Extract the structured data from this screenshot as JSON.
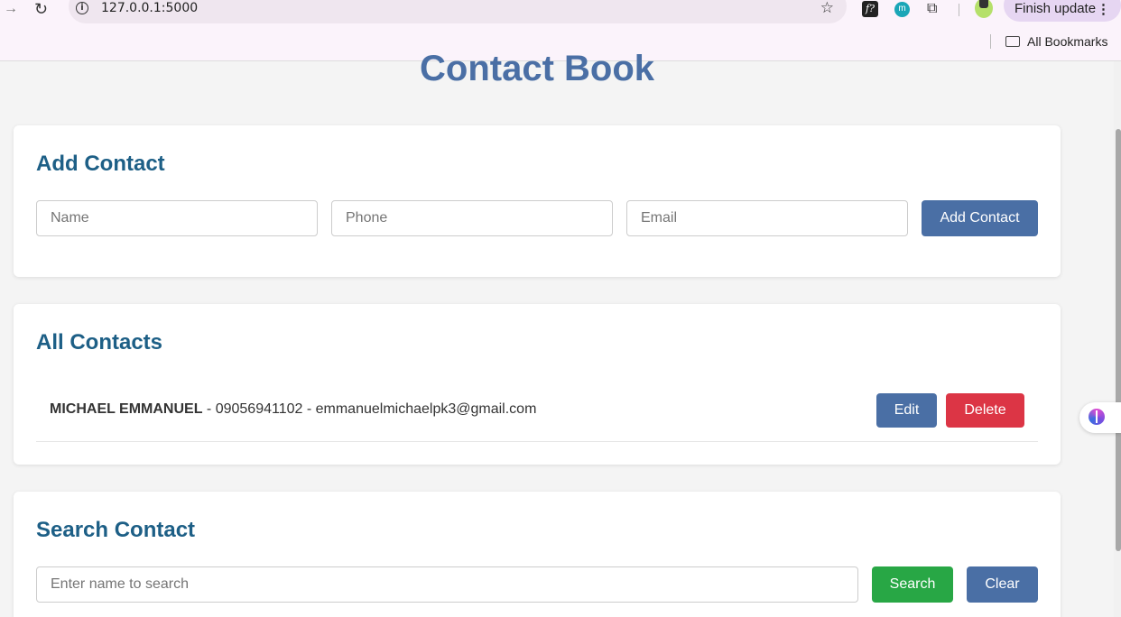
{
  "browser": {
    "url": "127.0.0.1:5000",
    "update_button": "Finish update",
    "bookmarks_label": "All Bookmarks",
    "ext_f_label": "f?",
    "ext_m_label": "m"
  },
  "page": {
    "title": "Contact Book"
  },
  "add_contact": {
    "heading": "Add Contact",
    "name_placeholder": "Name",
    "phone_placeholder": "Phone",
    "email_placeholder": "Email",
    "submit_label": "Add Contact"
  },
  "all_contacts": {
    "heading": "All Contacts",
    "contacts": [
      {
        "name": "MICHAEL EMMANUEL",
        "separator1": " - ",
        "phone": "09056941102",
        "separator2": " - ",
        "email": "emmanuelmichaelpk3@gmail.com",
        "edit_label": "Edit",
        "delete_label": "Delete"
      }
    ]
  },
  "search": {
    "heading": "Search Contact",
    "placeholder": "Enter name to search",
    "search_label": "Search",
    "clear_label": "Clear"
  },
  "colors": {
    "primary": "#4a6fa5",
    "heading": "#1d5f86",
    "danger": "#dc3545",
    "success": "#28a745"
  }
}
